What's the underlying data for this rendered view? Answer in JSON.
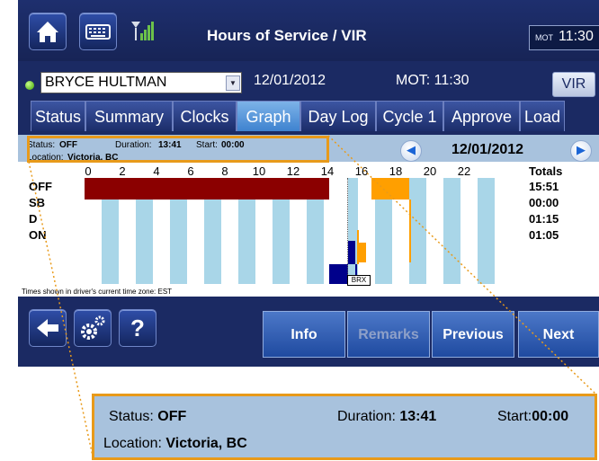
{
  "header": {
    "title": "Hours of Service / VIR",
    "clock_prefix": "MOT",
    "clock_time": "11:30"
  },
  "driver": {
    "name": "BRYCE HULTMAN",
    "date": "12/01/2012",
    "mot_time": "MOT: 11:30",
    "vir_label": "VIR"
  },
  "tabs": [
    {
      "label": "Status"
    },
    {
      "label": "Summary"
    },
    {
      "label": "Clocks"
    },
    {
      "label": "Graph"
    },
    {
      "label": "Day Log"
    },
    {
      "label": "Cycle 1"
    },
    {
      "label": "Approve"
    },
    {
      "label": "Load"
    }
  ],
  "active_tab": "Graph",
  "status_info": {
    "status_label": "Status:",
    "status_value": "OFF",
    "duration_label": "Duration:",
    "duration_value": "13:41",
    "start_label": "Start:",
    "start_value": "00:00",
    "location_label": "Location:",
    "location_value": "Victoria, BC"
  },
  "nav": {
    "date": "12/01/2012"
  },
  "graph": {
    "hours": [
      "0",
      "2",
      "4",
      "6",
      "8",
      "10",
      "12",
      "14",
      "16",
      "18",
      "20",
      "22"
    ],
    "rows": [
      "OFF",
      "SB",
      "D",
      "ON"
    ],
    "totals_header": "Totals",
    "totals": [
      "15:51",
      "00:00",
      "01:15",
      "01:05"
    ],
    "marker": "BRX",
    "timezone_note": "Times shown in driver's current time zone:  EST",
    "colors": {
      "off": "#8b0000",
      "d": "#ff9f00",
      "on": "#00008b",
      "band": "#a9d6e8"
    }
  },
  "toolbar": {
    "info": "Info",
    "remarks": "Remarks",
    "previous": "Previous",
    "next": "Next"
  },
  "icons": {
    "home": "home-icon",
    "keyboard": "keyboard-icon",
    "signal": "signal-icon",
    "back": "back-arrow-icon",
    "settings": "gear-icon",
    "help": "help-icon"
  }
}
